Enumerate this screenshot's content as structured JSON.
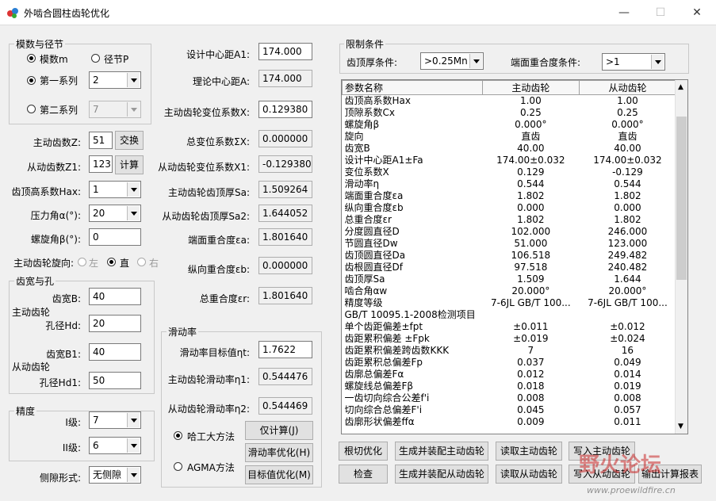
{
  "window": {
    "title": "外啮合圆柱齿轮优化"
  },
  "module_group": {
    "legend": "模数与径节",
    "radio_module": "模数m",
    "radio_pitch": "径节P",
    "radio_series1": "第一系列",
    "series1_value": "2",
    "radio_series2": "第二系列",
    "series2_value": "7"
  },
  "left": {
    "z_label": "主动齿数Z:",
    "z_value": "51",
    "swap_btn": "交换",
    "z1_label": "从动齿数Z1:",
    "z1_value": "123",
    "calc_btn": "计算",
    "hax_label": "齿顶高系数Hax:",
    "hax_value": "1",
    "alpha_label": "压力角α(°):",
    "alpha_value": "20",
    "beta_label": "螺旋角β(°):",
    "beta_value": "0",
    "dir_label": "主动齿轮旋向:",
    "dir_left": "左",
    "dir_straight": "直",
    "dir_right": "右"
  },
  "width_group": {
    "legend": "齿宽与孔",
    "driver": "主动齿轮",
    "driven": "从动齿轮",
    "b_label": "齿宽B:",
    "b_value": "40",
    "hd_label": "孔径Hd:",
    "hd_value": "20",
    "b1_label": "齿宽B1:",
    "b1_value": "40",
    "hd1_label": "孔径Hd1:",
    "hd1_value": "50"
  },
  "precision_group": {
    "legend": "精度",
    "i_label": "I级:",
    "i_value": "7",
    "ii_label": "II级:",
    "ii_value": "6"
  },
  "flank": {
    "label": "侧隙形式:",
    "value": "无侧隙"
  },
  "center": {
    "a1_label": "设计中心距A1:",
    "a1_value": "174.000",
    "a_label": "理论中心距A:",
    "a_value": "174.000",
    "x_label": "主动齿轮变位系数X:",
    "x_value": "0.129380",
    "sx_label": "总变位系数ΣX:",
    "sx_value": "0.000000",
    "x1_label": "从动齿轮变位系数X1:",
    "x1_value": "-0.129380",
    "sa_label": "主动齿轮齿顶厚Sa:",
    "sa_value": "1.509264",
    "sa2_label": "从动齿轮齿顶厚Sa2:",
    "sa2_value": "1.644052",
    "ea_label": "端面重合度εa:",
    "ea_value": "1.801640",
    "eb_label": "纵向重合度εb:",
    "eb_value": "0.000000",
    "er_label": "总重合度εr:",
    "er_value": "1.801640"
  },
  "slide_group": {
    "legend": "滑动率",
    "target_label": "滑动率目标值ηt:",
    "target_value": "1.7622",
    "n1_label": "主动齿轮滑动率η1:",
    "n1_value": "0.544476",
    "n2_label": "从动齿轮滑动率η2:",
    "n2_value": "0.544469",
    "method_harbin": "哈工大方法",
    "method_agma": "AGMA方法",
    "btn_calc_only": "仅计算(J)",
    "btn_slide_opt": "滑动率优化(H)",
    "btn_target_opt": "目标值优化(M)"
  },
  "limits": {
    "legend": "限制条件",
    "top_thick_label": "齿顶厚条件:",
    "top_thick_value": ">0.25Mn",
    "overlap_label": "端面重合度条件:",
    "overlap_value": ">1"
  },
  "table": {
    "headers": [
      "参数名称",
      "主动齿轮",
      "从动齿轮"
    ],
    "rows": [
      [
        "齿顶高系数Hax",
        "1.00",
        "1.00"
      ],
      [
        "顶隙系数Cx",
        "0.25",
        "0.25"
      ],
      [
        "螺旋角β",
        "0.000°",
        "0.000°"
      ],
      [
        "旋向",
        "直齿",
        "直齿"
      ],
      [
        "齿宽B",
        "40.00",
        "40.00"
      ],
      [
        "设计中心距A1±Fa",
        "174.00±0.032",
        "174.00±0.032"
      ],
      [
        "变位系数X",
        "0.129",
        "-0.129"
      ],
      [
        "滑动率η",
        "0.544",
        "0.544"
      ],
      [
        "端面重合度εa",
        "1.802",
        "1.802"
      ],
      [
        "纵向重合度εb",
        "0.000",
        "0.000"
      ],
      [
        "总重合度εr",
        "1.802",
        "1.802"
      ],
      [
        "分度圆直径D",
        "102.000",
        "246.000"
      ],
      [
        "节圆直径Dw",
        "51.000",
        "123.000"
      ],
      [
        "齿顶圆直径Da",
        "106.518",
        "249.482"
      ],
      [
        "齿根圆直径Df",
        "97.518",
        "240.482"
      ],
      [
        "齿顶厚Sa",
        "1.509",
        "1.644"
      ],
      [
        "啮合角αw",
        "20.000°",
        "20.000°"
      ],
      [
        "精度等级",
        "7-6JL GB/T 100...",
        "7-6JL GB/T 100..."
      ],
      [
        "GB/T 10095.1-2008检测项目",
        "",
        ""
      ],
      [
        "单个齿距偏差±fpt",
        "±0.011",
        "±0.012"
      ],
      [
        "齿距累积偏差 ±Fpk",
        "±0.019",
        "±0.024"
      ],
      [
        "齿距累积偏差跨齿数KKK",
        "7",
        "16"
      ],
      [
        "齿距累积总偏差Fp",
        "0.037",
        "0.049"
      ],
      [
        "齿廓总偏差Fα",
        "0.012",
        "0.014"
      ],
      [
        "螺旋线总偏差Fβ",
        "0.018",
        "0.019"
      ],
      [
        "一齿切向综合公差f'i",
        "0.008",
        "0.008"
      ],
      [
        "切向综合总偏差F'i",
        "0.045",
        "0.057"
      ],
      [
        "齿廓形状偏差ffα",
        "0.009",
        "0.011"
      ]
    ]
  },
  "bottom_buttons": {
    "root_cut": "根切优化",
    "gen_driver": "生成并装配主动齿轮",
    "read_driver": "读取主动齿轮",
    "write_driver": "写入主动齿轮",
    "check": "检查",
    "gen_driven": "生成并装配从动齿轮",
    "read_driven": "读取从动齿轮",
    "write_driven": "写入从动齿轮",
    "output_report": "输出计算报表"
  },
  "watermark": {
    "logo": "野火论坛",
    "url": "www.proewildfire.cn"
  }
}
